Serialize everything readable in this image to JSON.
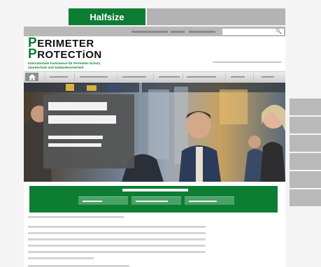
{
  "tabs": {
    "active_label": "Halfsize"
  },
  "logo": {
    "line1_initial": "P",
    "line1_rest": "ERIMETER",
    "line2_initial": "P",
    "line2_rest": "ROTECTiON",
    "tagline_1": "Internationale Fachmesse für Perimeter-Schutz,",
    "tagline_2": "Zauntechnik und Gebäudesicherheit"
  },
  "icons": {
    "search": "search-icon",
    "home": "home-icon"
  },
  "colors": {
    "brand_green": "#0e7d34",
    "placeholder_gray": "#b3b3b3",
    "overlay_gray": "#555555"
  }
}
